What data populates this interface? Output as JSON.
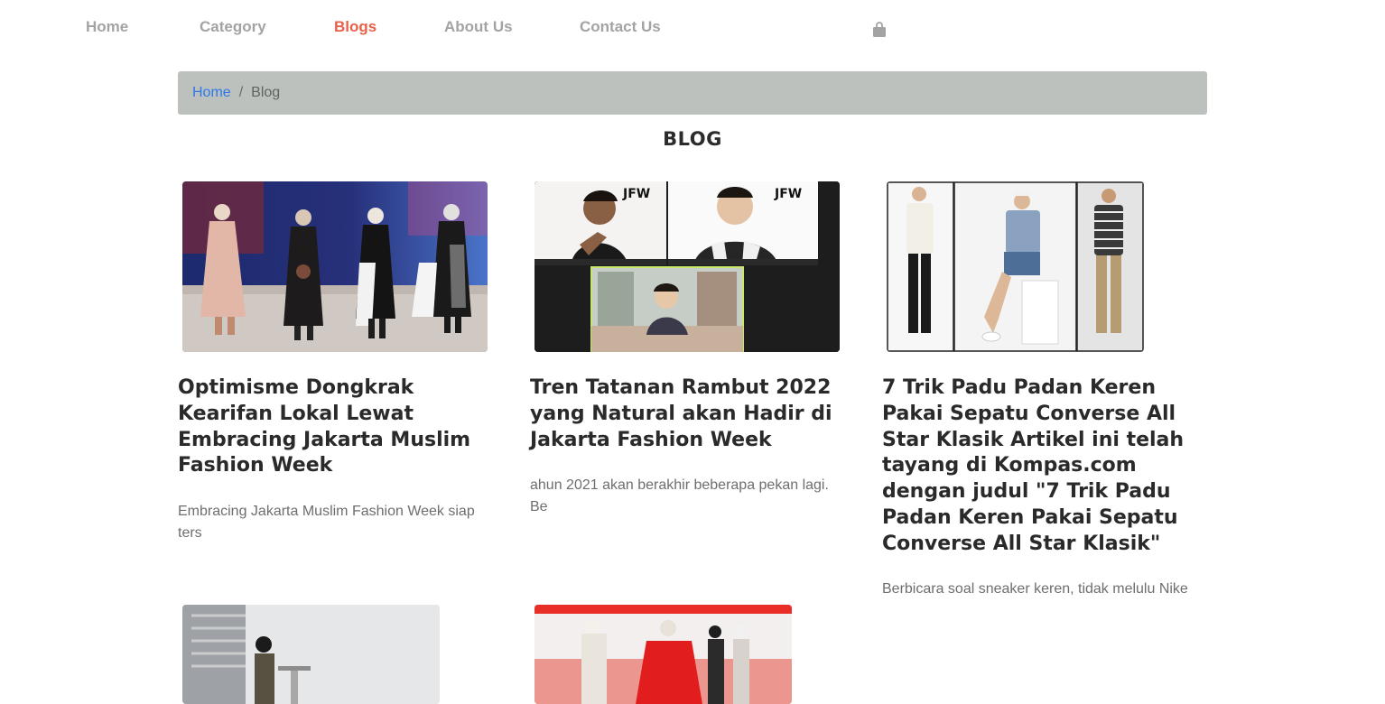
{
  "nav": {
    "items": [
      {
        "label": "Home",
        "active": false
      },
      {
        "label": "Category",
        "active": false
      },
      {
        "label": "Blogs",
        "active": true
      },
      {
        "label": "About Us",
        "active": false
      },
      {
        "label": "Contact Us",
        "active": false
      }
    ],
    "cart_icon": "shopping-bag-icon",
    "active_color": "#e8604a",
    "inactive_color": "#a3a3a3"
  },
  "breadcrumb": {
    "home": "Home",
    "separator": "/",
    "current": "Blog"
  },
  "page": {
    "title": "BLOG"
  },
  "posts": [
    {
      "title": "Optimisme Dongkrak Kearifan Lokal Lewat Embracing Jakarta Muslim Fashion Week",
      "excerpt": "Embracing Jakarta Muslim Fashion Week siap ters"
    },
    {
      "title": "Tren Tatanan Rambut 2022 yang Natural akan Hadir di Jakarta Fashion Week",
      "excerpt": "ahun 2021 akan berakhir beberapa pekan lagi. Be",
      "video_call_labels": [
        "JFW",
        "JFW"
      ]
    },
    {
      "title": "7 Trik Padu Padan Keren Pakai Sepatu Converse All Star Klasik Artikel ini telah tayang di Kompas.com dengan judul \"7 Trik Padu Padan Keren Pakai Sepatu Converse All Star Klasik\"",
      "excerpt": "Berbicara soal sneaker keren, tidak melulu Nike"
    },
    {
      "title": "",
      "excerpt": ""
    },
    {
      "title": "",
      "excerpt": ""
    }
  ],
  "colors": {
    "breadcrumb_bg": "#bdc1be",
    "link_blue": "#2f78e8",
    "title_text": "#2a2a2a",
    "excerpt_text": "#6e6e6e"
  }
}
